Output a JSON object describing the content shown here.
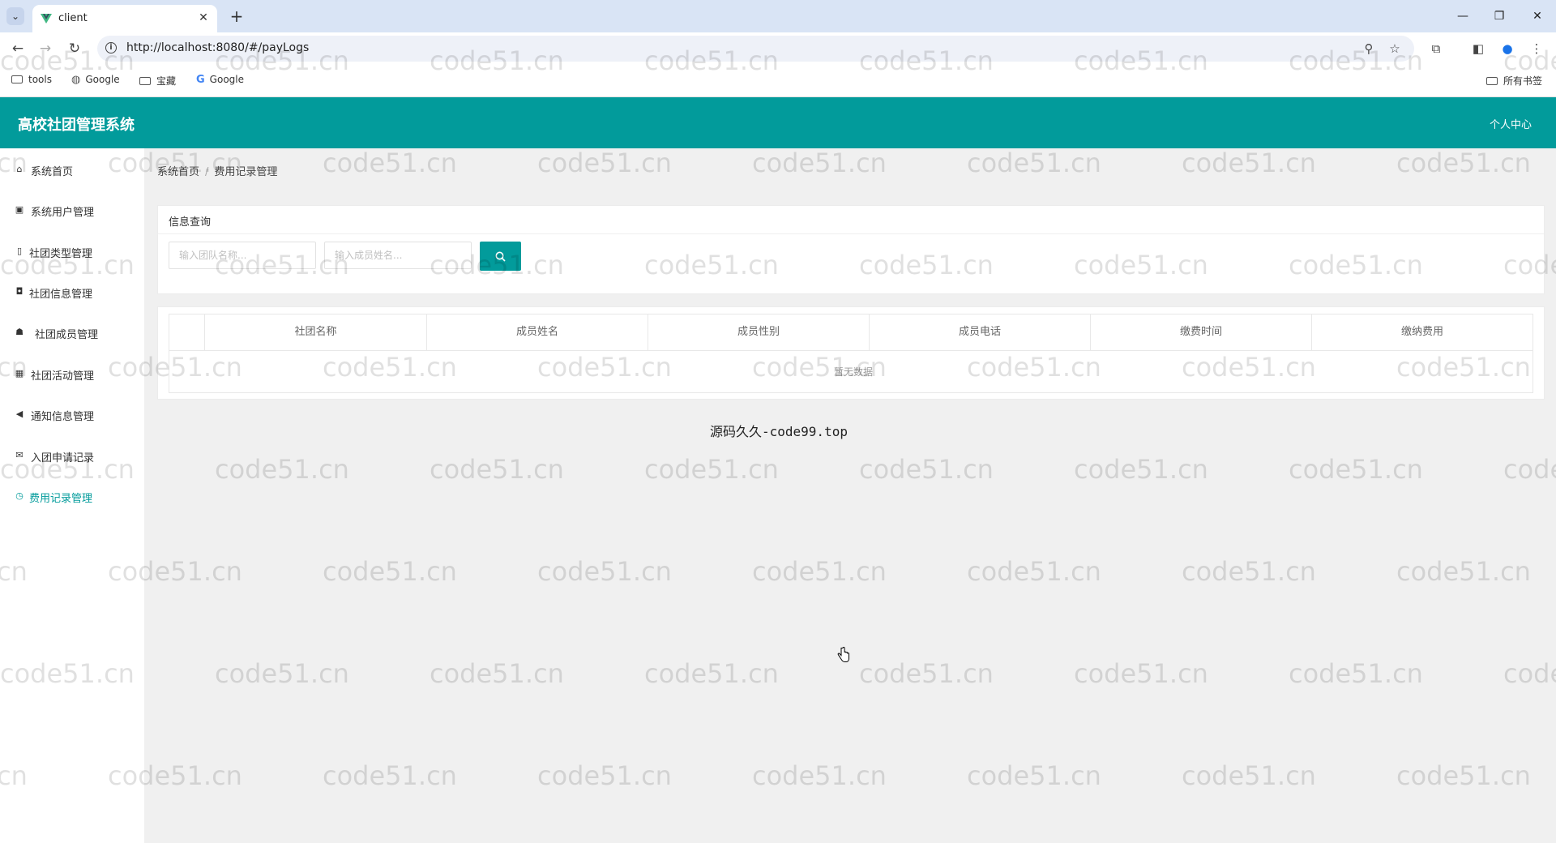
{
  "browser": {
    "tab_title": "client",
    "new_tab_symbol": "+",
    "url": "http://localhost:8080/#/payLogs",
    "bookmarks": [
      {
        "label": "tools",
        "icon": "folder-icon"
      },
      {
        "label": "Google",
        "icon": "globe-icon"
      },
      {
        "label": "宝藏",
        "icon": "folder-icon"
      },
      {
        "label": "Google",
        "icon": "google-icon"
      }
    ],
    "all_bookmarks": "所有书签"
  },
  "app": {
    "title": "高校社团管理系统",
    "user_center": "个人中心",
    "accent_color": "#029b9b"
  },
  "sidebar": {
    "items": [
      {
        "label": "系统首页",
        "icon": "home-icon"
      },
      {
        "label": "系统用户管理",
        "icon": "user-card-icon"
      },
      {
        "label": "社团类型管理",
        "icon": "book-icon"
      },
      {
        "label": "社团信息管理",
        "icon": "train-icon"
      },
      {
        "label": "社团成员管理",
        "icon": "group-icon"
      },
      {
        "label": "社团活动管理",
        "icon": "calendar-icon"
      },
      {
        "label": "通知信息管理",
        "icon": "megaphone-icon"
      },
      {
        "label": "入团申请记录",
        "icon": "envelope-icon"
      },
      {
        "label": "费用记录管理",
        "icon": "clock-icon",
        "active": true
      }
    ]
  },
  "breadcrumb": {
    "home": "系统首页",
    "separator": "/",
    "current": "费用记录管理"
  },
  "search": {
    "panel_title": "信息查询",
    "team_placeholder": "输入团队名称...",
    "member_placeholder": "输入成员姓名...",
    "button_icon": "search-icon"
  },
  "table": {
    "columns": [
      "社团名称",
      "成员姓名",
      "成员性别",
      "成员电话",
      "缴费时间",
      "缴纳费用"
    ],
    "empty_text": "暂无数据"
  },
  "footer_text": "源码久久-code99.top",
  "watermark": "code51.cn"
}
